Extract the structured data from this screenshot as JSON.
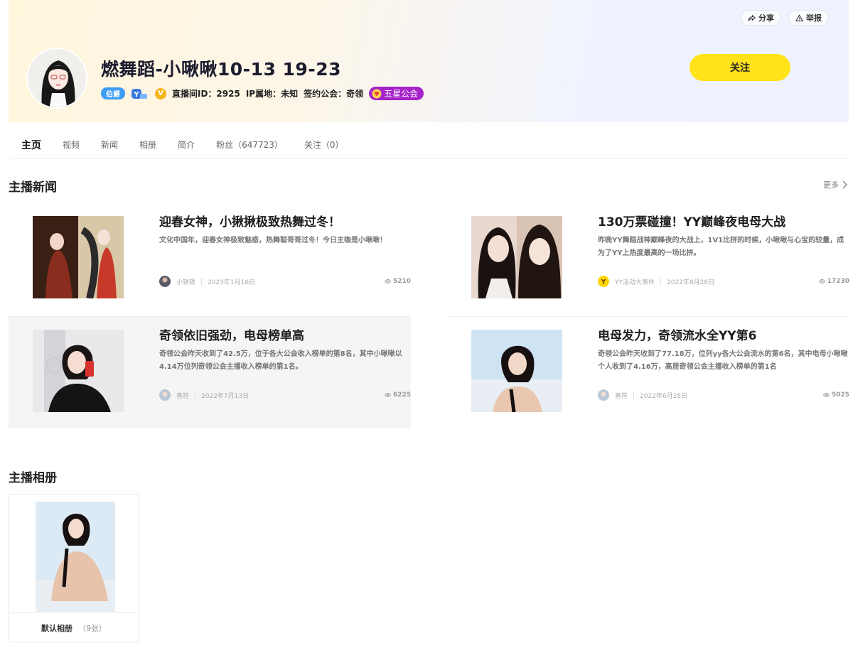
{
  "header": {
    "share_label": "分享",
    "report_label": "举报",
    "title": "燃舞蹈-小啾啾10-13 19-23",
    "rank_badge": "伯爵",
    "room_id": "直播间ID：2925",
    "ip_location": "IP属地：未知",
    "guild_label": "签约公会：奇领",
    "guild_badge": "五星公会",
    "follow_label": "关注",
    "colors": {
      "follow": "#ffe21a",
      "guild": "#a523c9",
      "rank": "#3d9df5"
    }
  },
  "tabs": [
    {
      "label": "主页",
      "active": true
    },
    {
      "label": "视频"
    },
    {
      "label": "新闻"
    },
    {
      "label": "相册"
    },
    {
      "label": "简介"
    },
    {
      "label": "粉丝（647723）"
    },
    {
      "label": "关注（0）"
    }
  ],
  "news": {
    "title": "主播新闻",
    "more_label": "更多",
    "items": [
      {
        "title": "迎春女神，小揪揪极致热舞过冬！",
        "desc": "文化中国年，迎春女神极致魅惑，热舞聪哥哥过冬！今日主咖是小啾啾！",
        "author": "小铁铁",
        "date": "2023年1月16日",
        "views": "5210"
      },
      {
        "title": "130万票碰撞！YY巅峰夜电母大战",
        "desc": "昨晚YY舞蹈战神巅峰夜的大战上，1V1比拼的时候，小啾啾与心宝的较量，成为了YY上热度最高的一场比拼。",
        "author": "YY活动大事件",
        "date": "2022年8月26日",
        "views": "17230"
      },
      {
        "title": "奇领依旧强劲，电母榜单高",
        "desc": "奇领公会昨天收到了42.5万，位于各大公会收入榜单的第8名，其中小啾啾以4.14万位列奇领公会主播收入榜单的第1名。",
        "author": "喜符",
        "date": "2022年7月13日",
        "views": "6225"
      },
      {
        "title": "电母发力，奇领流水全YY第6",
        "desc": "奇领公会昨天收到了77.18万，位列yy各大公会流水的第6名，其中电母小啾啾个人收到了4.16万，高居奇领公会主播收入榜单的第1名",
        "author": "喜符",
        "date": "2022年6月28日",
        "views": "5025"
      }
    ]
  },
  "album": {
    "title": "主播相册",
    "name": "默认相册",
    "count": "（9张）"
  }
}
